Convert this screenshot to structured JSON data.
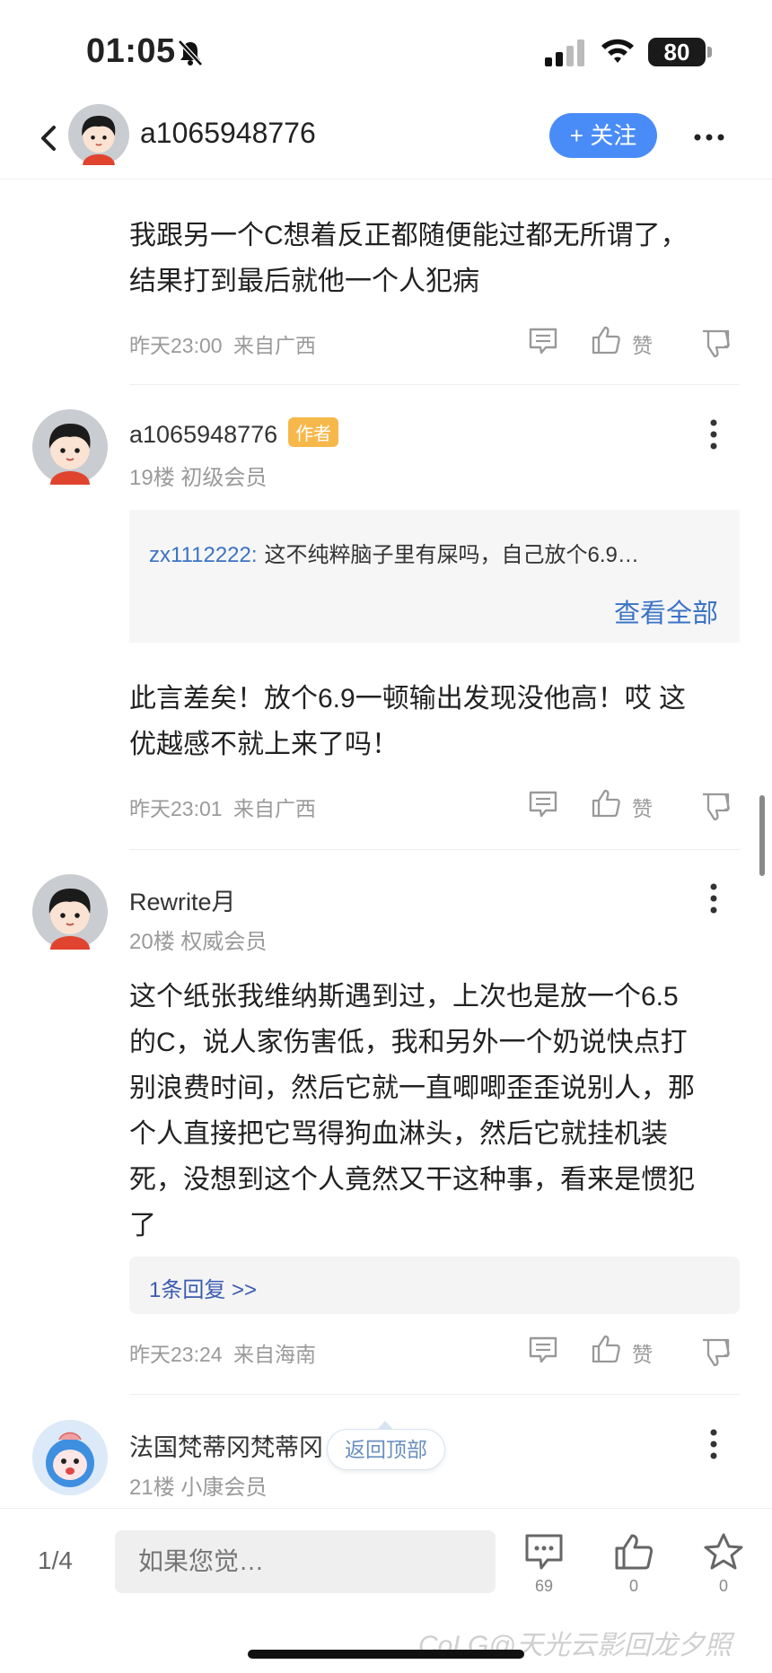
{
  "status_bar": {
    "time": "01:05",
    "battery": "80"
  },
  "header": {
    "username": "a1065948776",
    "follow_label": "+ 关注"
  },
  "posts": [
    {
      "text_lines": [
        "我跟另一个C想着反正都随便能过都无所谓了，",
        "结果打到最后就他一个人犯病"
      ],
      "time": "昨天23:00",
      "location": "来自广西",
      "like_label": "赞"
    },
    {
      "username": "a1065948776",
      "badge": "作者",
      "floor": "19楼",
      "level": "初级会员",
      "quote": {
        "user": "zx1112222:",
        "text": "这不纯粹脑子里有屎吗，自己放个6.9…",
        "view_all": "查看全部"
      },
      "text_lines": [
        "此言差矣！放个6.9一顿输出发现没他高！哎 这",
        "优越感不就上来了吗！"
      ],
      "time": "昨天23:01",
      "location": "来自广西",
      "like_label": "赞"
    },
    {
      "username": "Rewrite月",
      "floor": "20楼",
      "level": "权威会员",
      "text_lines": [
        "这个纸张我维纳斯遇到过，上次也是放一个6.5",
        "的C，说人家伤害低，我和另外一个奶说快点打",
        "别浪费时间，然后它就一直唧唧歪歪说别人，那",
        "个人直接把它骂得狗血淋头，然后它就挂机装",
        "死，没想到这个人竟然又干这种事，看来是惯犯",
        "了"
      ],
      "reply_count": "1条回复 >>",
      "time": "昨天23:24",
      "location": "来自海南",
      "like_label": "赞"
    },
    {
      "username": "法国梵蒂冈梵蒂冈",
      "floor": "21楼",
      "level": "小康会员"
    }
  ],
  "back_to_top": "返回顶部",
  "bottom_bar": {
    "page": "1/4",
    "input_placeholder": "如果您觉…",
    "comments": "69",
    "likes": "0",
    "favorites": "0"
  },
  "watermark": "CoLG@天光云影回龙夕照",
  "colors": {
    "accent": "#4a8cf7",
    "link": "#3b73c4",
    "badge": "#f7b84b"
  }
}
